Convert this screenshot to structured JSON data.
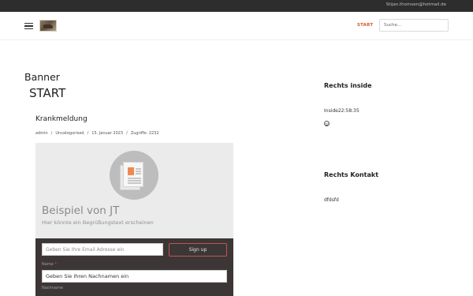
{
  "topbar": {
    "email": "Stijan.thomsen@hotmail.de"
  },
  "header": {
    "nav_start": "START",
    "search_placeholder": "Suche..."
  },
  "main": {
    "banner_label": "Banner",
    "page_title": "START",
    "article": {
      "title": "Krankmeldung",
      "meta": {
        "author": "admin",
        "category": "Uncategorised",
        "date": "15. Januar 2023",
        "hits": "Zugriffe: 2232"
      }
    },
    "hero": {
      "title": "Beispiel von JT",
      "subtitle": "Hier könnte ein Begrüßungstext erscheinen"
    },
    "signup": {
      "email_placeholder": "Geben Sie Ihre Email Adresse ein",
      "button_label": "Sign up",
      "name_label": "Name",
      "name_required_mark": "*",
      "lastname_placeholder": "Geben Sie Ihren Nachnamen ein",
      "lastname_label": "Nachname"
    }
  },
  "sidebar": {
    "inside_heading": "Rechts inside",
    "inside_text": "Inside22:58:35",
    "emoji_icon": "smiley-icon",
    "contact_heading": "Rechts Kontakt",
    "contact_text": "dfdsfd"
  },
  "colors": {
    "topbar_bg": "#2d2d2d",
    "accent": "#d4582c",
    "signup_bg": "#3d3636",
    "button_border": "#c0564e"
  }
}
